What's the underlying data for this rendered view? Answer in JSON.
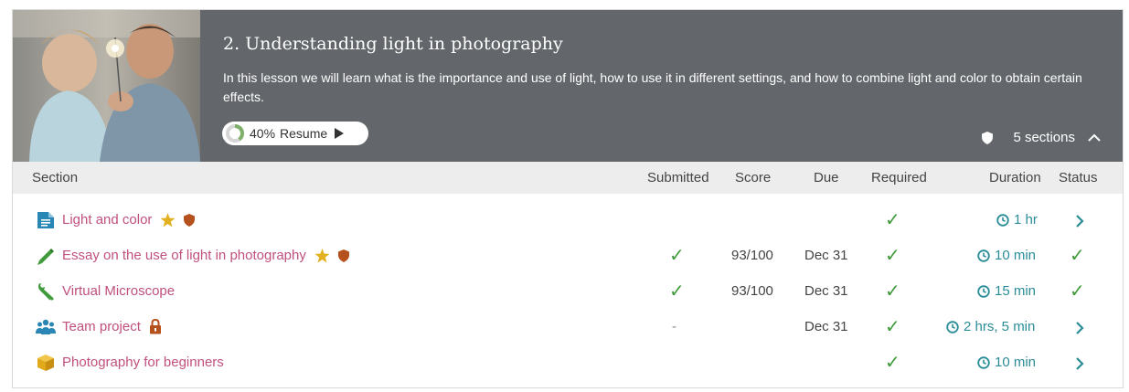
{
  "lesson": {
    "title": "2. Understanding light in photography",
    "description": "In this lesson we will learn what is the importance and use of light, how to use it in different settings, and how to combine light and color to obtain certain effects.",
    "progress_percent": 40,
    "progress_label": "40%",
    "resume_label": "Resume",
    "sections_label": "5 sections"
  },
  "columns": {
    "section": "Section",
    "submitted": "Submitted",
    "score": "Score",
    "due": "Due",
    "required": "Required",
    "duration": "Duration",
    "status": "Status"
  },
  "rows": [
    {
      "title": "Light and color",
      "icon": "document-icon",
      "starred": true,
      "shield": true,
      "lock": false,
      "submitted": "",
      "score": "",
      "due": "",
      "required": "✓",
      "duration": "1 hr",
      "status": "chevron"
    },
    {
      "title": "Essay on the use of light in photography",
      "icon": "pencil-icon",
      "starred": true,
      "shield": true,
      "lock": false,
      "submitted": "✓",
      "score": "93/100",
      "due": "Dec 31",
      "required": "✓",
      "duration": "10 min",
      "status": "check"
    },
    {
      "title": "Virtual Microscope",
      "icon": "wrench-icon",
      "starred": false,
      "shield": false,
      "lock": false,
      "submitted": "✓",
      "score": "93/100",
      "due": "Dec 31",
      "required": "✓",
      "duration": "15 min",
      "status": "check"
    },
    {
      "title": "Team project",
      "icon": "team-icon",
      "starred": false,
      "shield": false,
      "lock": true,
      "submitted": "-",
      "score": "",
      "due": "Dec 31",
      "required": "✓",
      "duration": "2 hrs, 5 min",
      "status": "chevron"
    },
    {
      "title": "Photography for beginners",
      "icon": "package-icon",
      "starred": false,
      "shield": false,
      "lock": false,
      "submitted": "",
      "score": "",
      "due": "",
      "required": "✓",
      "duration": "10 min",
      "status": "chevron"
    }
  ],
  "glyphs": {
    "check": "✓",
    "chevron_right": "›",
    "chevron_up": "︿"
  },
  "colors": {
    "header_bg": "#63676b",
    "title_link": "#c0507e",
    "check_green": "#3f9a3a",
    "accent_teal": "#2a8c96",
    "star": "#e3b020",
    "shield": "#b5511c"
  }
}
